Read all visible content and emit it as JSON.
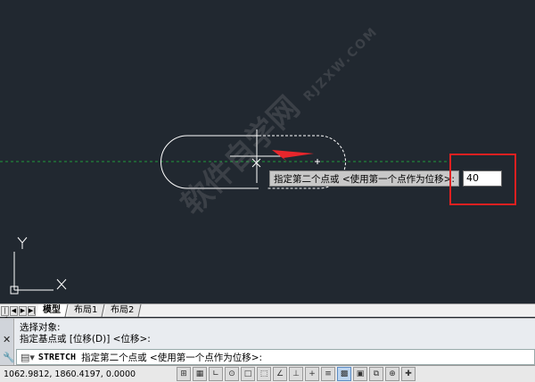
{
  "drawing": {
    "tooltip_text": "指定第二个点或 <使用第一个点作为位移>:",
    "dynamic_input_value": "40",
    "watermark_text": "软件自学网",
    "watermark_url": "RJZXW.COM",
    "ucs_x_label": "X",
    "ucs_y_label": "Y",
    "colors": {
      "background": "#212830",
      "geometry": "#ffffff",
      "axis_dashed": "#1f9a3c",
      "highlight_box": "#e02020",
      "arrow": "#e8262c"
    }
  },
  "layout_tabs": {
    "nav_buttons": [
      "first",
      "prev",
      "next",
      "last"
    ],
    "tabs": [
      {
        "label": "模型",
        "active": true
      },
      {
        "label": "布局1",
        "active": false
      },
      {
        "label": "布局2",
        "active": false
      }
    ]
  },
  "command_window": {
    "history": [
      "选择对象:",
      "指定基点或 [位移(D)] <位移>:"
    ],
    "current_command": "STRETCH",
    "current_prompt": "指定第二个点或 <使用第一个点作为位移>:"
  },
  "status_bar": {
    "coordinates": "1062.9812, 1860.4197, 0.0000",
    "toggles": [
      {
        "icon": "snap-icon",
        "on": false
      },
      {
        "icon": "grid-icon",
        "on": false
      },
      {
        "icon": "ortho-icon",
        "on": false
      },
      {
        "icon": "polar-icon",
        "on": false
      },
      {
        "icon": "osnap-icon",
        "on": false
      },
      {
        "icon": "3dosnap-icon",
        "on": false
      },
      {
        "icon": "otrack-icon",
        "on": false
      },
      {
        "icon": "ducs-icon",
        "on": false
      },
      {
        "icon": "dyn-icon",
        "on": false
      },
      {
        "icon": "lineweight-icon",
        "on": false
      },
      {
        "icon": "transparency-icon",
        "on": false
      },
      {
        "icon": "quickprops-icon",
        "on": true
      },
      {
        "icon": "selection-cycling-icon",
        "on": false
      },
      {
        "icon": "annotation-monitor-icon",
        "on": false
      },
      {
        "icon": "plus-icon",
        "on": false
      }
    ]
  }
}
